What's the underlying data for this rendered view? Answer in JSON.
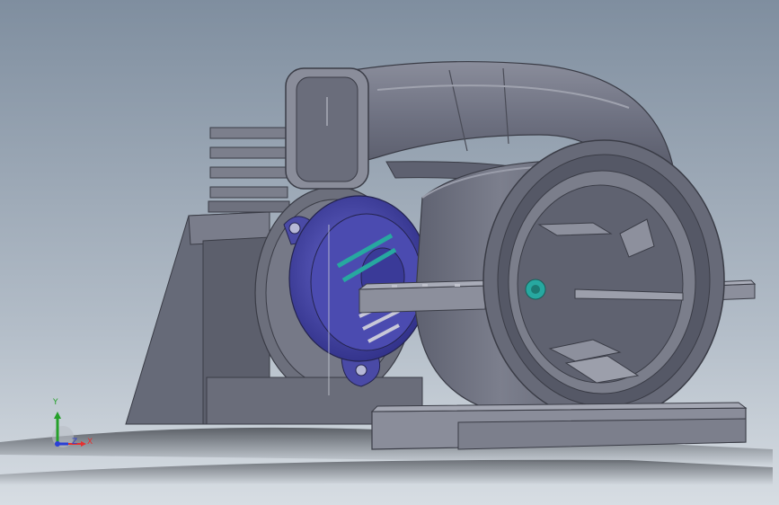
{
  "viewport": {
    "background_top": "#7f8e9f",
    "background_bottom": "#d7dde3",
    "model_color": "#6f7382",
    "model_dark": "#4d505c",
    "model_light": "#9a9daa",
    "bearing_color": "#4a4aa6",
    "accent_teal": "#27a8a0"
  },
  "triad": {
    "x_label": "X",
    "y_label": "Y",
    "z_label": "Z",
    "x_color": "#e53030",
    "y_color": "#25a02a",
    "z_color": "#2a3fd6"
  }
}
